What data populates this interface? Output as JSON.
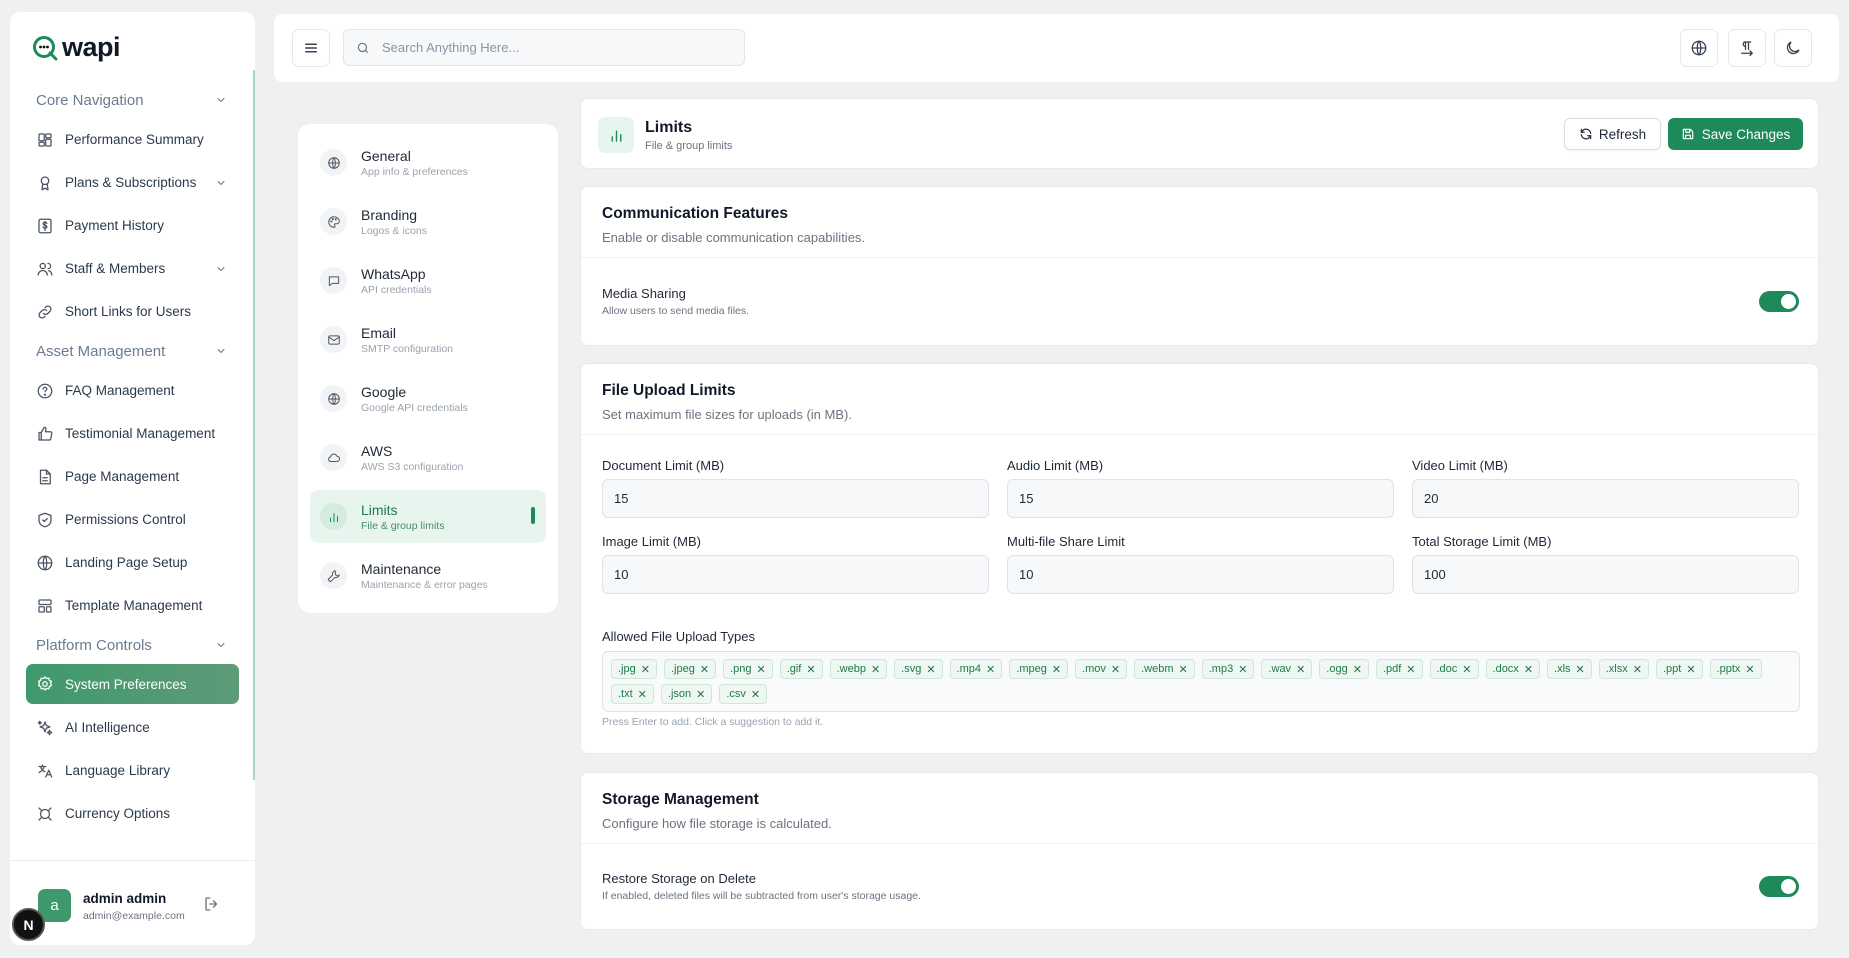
{
  "brand": {
    "name": "wapi",
    "accent": "#1e8a5a"
  },
  "sidebar": {
    "sections": [
      {
        "title": "Core Navigation",
        "items": [
          {
            "label": "Performance Summary",
            "icon": "dashboard-icon",
            "chevron": false
          },
          {
            "label": "Plans & Subscriptions",
            "icon": "award-icon",
            "chevron": true
          },
          {
            "label": "Payment History",
            "icon": "dollar-icon",
            "chevron": false
          },
          {
            "label": "Staff & Members",
            "icon": "users-icon",
            "chevron": true
          },
          {
            "label": "Short Links for Users",
            "icon": "link-icon",
            "chevron": false
          }
        ]
      },
      {
        "title": "Asset Management",
        "items": [
          {
            "label": "FAQ Management",
            "icon": "help-icon",
            "chevron": false
          },
          {
            "label": "Testimonial Management",
            "icon": "thumbs-up-icon",
            "chevron": false
          },
          {
            "label": "Page Management",
            "icon": "file-icon",
            "chevron": false
          },
          {
            "label": "Permissions Control",
            "icon": "shield-icon",
            "chevron": false
          },
          {
            "label": "Landing Page Setup",
            "icon": "globe-icon",
            "chevron": false
          },
          {
            "label": "Template Management",
            "icon": "layout-icon",
            "chevron": false
          }
        ]
      },
      {
        "title": "Platform Controls",
        "items": [
          {
            "label": "System Preferences",
            "icon": "gear-icon",
            "chevron": false,
            "active": true
          },
          {
            "label": "AI Intelligence",
            "icon": "sparkles-icon",
            "chevron": false
          },
          {
            "label": "Language Library",
            "icon": "translate-icon",
            "chevron": false
          },
          {
            "label": "Currency Options",
            "icon": "currency-icon",
            "chevron": false
          }
        ]
      }
    ],
    "user": {
      "initial": "a",
      "name": "admin admin",
      "email": "admin@example.com"
    },
    "n_badge": "N"
  },
  "header": {
    "search_placeholder": "Search Anything Here..."
  },
  "settings_menu": [
    {
      "title": "General",
      "subtitle": "App info & preferences",
      "icon": "globe-icon"
    },
    {
      "title": "Branding",
      "subtitle": "Logos & icons",
      "icon": "palette-icon"
    },
    {
      "title": "WhatsApp",
      "subtitle": "API credentials",
      "icon": "message-icon"
    },
    {
      "title": "Email",
      "subtitle": "SMTP configuration",
      "icon": "mail-icon"
    },
    {
      "title": "Google",
      "subtitle": "Google API credentials",
      "icon": "globe-icon"
    },
    {
      "title": "AWS",
      "subtitle": "AWS S3 configuration",
      "icon": "cloud-icon"
    },
    {
      "title": "Limits",
      "subtitle": "File & group limits",
      "icon": "bar-chart-icon",
      "active": true
    },
    {
      "title": "Maintenance",
      "subtitle": "Maintenance & error pages",
      "icon": "wrench-icon"
    }
  ],
  "page": {
    "title": "Limits",
    "subtitle": "File & group limits",
    "refresh_label": "Refresh",
    "save_label": "Save Changes"
  },
  "communication": {
    "title": "Communication Features",
    "description": "Enable or disable communication capabilities.",
    "media_sharing": {
      "label": "Media Sharing",
      "description": "Allow users to send media files.",
      "enabled": true
    }
  },
  "upload": {
    "title": "File Upload Limits",
    "description": "Set maximum file sizes for uploads (in MB).",
    "fields": [
      {
        "label": "Document Limit (MB)",
        "value": "15"
      },
      {
        "label": "Audio Limit (MB)",
        "value": "15"
      },
      {
        "label": "Video Limit (MB)",
        "value": "20"
      },
      {
        "label": "Image Limit (MB)",
        "value": "10"
      },
      {
        "label": "Multi-file Share Limit",
        "value": "10"
      },
      {
        "label": "Total Storage Limit (MB)",
        "value": "100"
      }
    ],
    "types_label": "Allowed File Upload Types",
    "types": [
      ".jpg",
      ".jpeg",
      ".png",
      ".gif",
      ".webp",
      ".svg",
      ".mp4",
      ".mpeg",
      ".mov",
      ".webm",
      ".mp3",
      ".wav",
      ".ogg",
      ".pdf",
      ".doc",
      ".docx",
      ".xls",
      ".xlsx",
      ".ppt",
      ".pptx",
      ".txt",
      ".json",
      ".csv"
    ],
    "types_hint": "Press Enter to add. Click a suggestion to add it."
  },
  "storage": {
    "title": "Storage Management",
    "description": "Configure how file storage is calculated.",
    "restore": {
      "label": "Restore Storage on Delete",
      "description": "If enabled, deleted files will be subtracted from user's storage usage.",
      "enabled": true
    }
  }
}
